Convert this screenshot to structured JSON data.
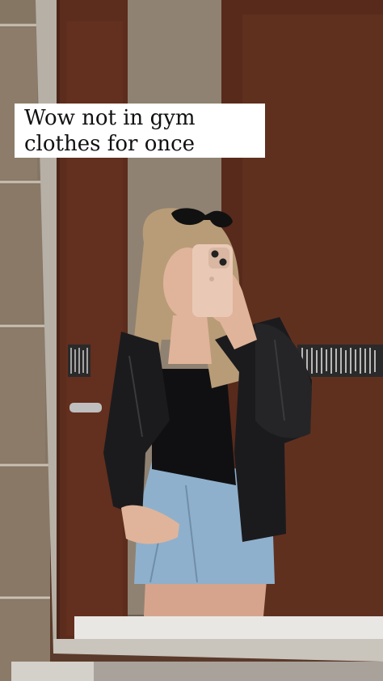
{
  "story": {
    "caption": "Wow not in gym clothes for once"
  },
  "colors": {
    "wall_tile": "#8a7a68",
    "mirror_frame": "#b7b2a9",
    "door_wood": "#5a2a1a",
    "jacket": "#1b1b1d",
    "denim": "#8fb0cc",
    "phone": "#e9c9b6",
    "caption_bg": "#ffffff",
    "caption_text": "#111111"
  }
}
